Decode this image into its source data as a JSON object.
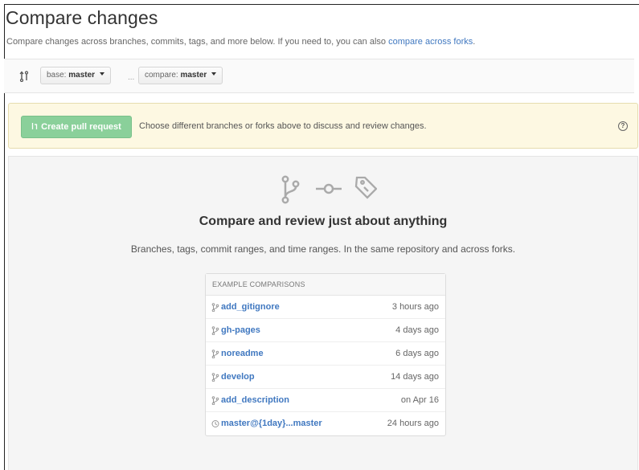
{
  "page": {
    "title": "Compare changes",
    "subtitle": "Compare changes across branches, commits, tags, and more below. If you need to, you can also ",
    "subtitle_link": "compare across forks",
    "subtitle_end": "."
  },
  "range": {
    "base_prefix": "base:",
    "base_value": "master",
    "separator": "...",
    "compare_prefix": "compare:",
    "compare_value": "master"
  },
  "flash": {
    "button_label": "Create pull request",
    "message": "Choose different branches or forks above to discuss and review changes.",
    "help_glyph": "?"
  },
  "blankslate": {
    "icons": [
      "git-branch-icon",
      "git-commit-icon",
      "tag-icon"
    ],
    "title": "Compare and review just about anything",
    "description": "Branches, tags, commit ranges, and time ranges. In the same repository and across forks."
  },
  "examples": {
    "header": "EXAMPLE COMPARISONS",
    "items": [
      {
        "icon": "git-branch-icon",
        "name": "add_gitignore",
        "time": "3 hours ago"
      },
      {
        "icon": "git-branch-icon",
        "name": "gh-pages",
        "time": "4 days ago"
      },
      {
        "icon": "git-branch-icon",
        "name": "noreadme",
        "time": "6 days ago"
      },
      {
        "icon": "git-branch-icon",
        "name": "develop",
        "time": "14 days ago"
      },
      {
        "icon": "git-branch-icon",
        "name": "add_description",
        "time": "on Apr 16"
      },
      {
        "icon": "history-icon",
        "name": "master@{1day}...master",
        "time": "24 hours ago"
      }
    ]
  },
  "colors": {
    "link": "#4078c0",
    "pr_button": "#8ad09a",
    "flash_bg": "#fdf8e2"
  }
}
